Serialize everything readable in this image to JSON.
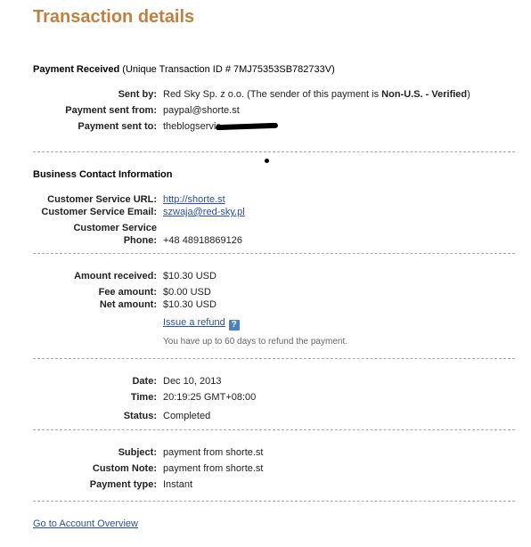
{
  "title": "Transaction details",
  "payment_header": {
    "label": "Payment Received",
    "detail": "(Unique Transaction ID # 7MJ75353SB782733V)"
  },
  "sender": {
    "sent_by_label": "Sent by:",
    "sent_by_value": "Red Sky Sp. z o.o. (The sender of this payment is ",
    "sent_by_status": "Non-U.S. - Verified",
    "sent_by_close": ")",
    "sent_from_label": "Payment sent from:",
    "sent_from_value": "paypal@shorte.st",
    "sent_to_label": "Payment sent to:",
    "sent_to_value": "theblogservic"
  },
  "business": {
    "heading": "Business Contact Information",
    "url_label": "Customer Service URL:",
    "url_value": "http://shorte.st",
    "email_label": "Customer Service Email:",
    "email_value": "szwaja@red-sky.pl",
    "phone_label_1": "Customer Service",
    "phone_label_2": "Phone:",
    "phone_value": "+48 48918869126"
  },
  "amounts": {
    "received_label": "Amount received:",
    "received_value": "$10.30 USD",
    "fee_label": "Fee amount:",
    "fee_value": "$0.00 USD",
    "net_label": "Net amount:",
    "net_value": "$10.30 USD",
    "refund_link": "Issue a refund",
    "help_icon": "?",
    "refund_note": "You have up to 60 days to refund the payment."
  },
  "timing": {
    "date_label": "Date:",
    "date_value": "Dec 10, 2013",
    "time_label": "Time:",
    "time_value": "20:19:25 GMT+08:00",
    "status_label": "Status:",
    "status_value": "Completed"
  },
  "details": {
    "subject_label": "Subject:",
    "subject_value": "payment from shorte.st",
    "note_label": "Custom Note:",
    "note_value": "payment from shorte.st",
    "type_label": "Payment type:",
    "type_value": "Instant"
  },
  "footer": {
    "overview_link": "Go to Account Overview"
  },
  "colors": {
    "title": "#c47f3e",
    "link": "#2850a0"
  }
}
